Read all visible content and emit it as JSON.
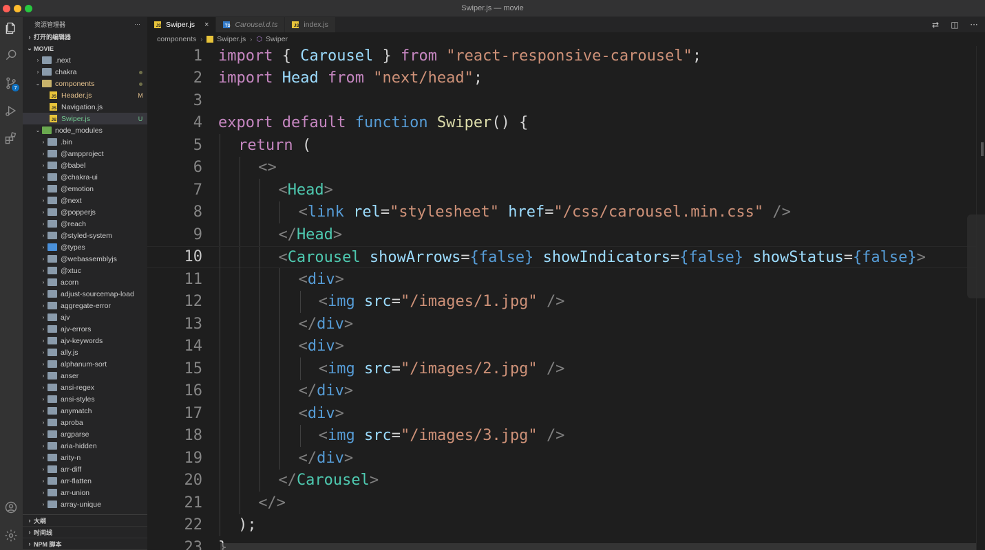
{
  "window": {
    "title": "Swiper.js — movie"
  },
  "activity": {
    "scm_badge": "7"
  },
  "sidebar": {
    "header": "资源管理器",
    "more": "···",
    "open_editors": "打开的编辑器",
    "root": "MOVIE",
    "tree": [
      {
        "name": ".next",
        "indent": 1,
        "kind": "folder",
        "status": ""
      },
      {
        "name": "chakra",
        "indent": 1,
        "kind": "folder",
        "status": "dot"
      },
      {
        "name": "components",
        "indent": 1,
        "kind": "folder-open",
        "status": "dot",
        "color": "mod"
      },
      {
        "name": "Header.js",
        "indent": 2,
        "kind": "js",
        "status": "M",
        "color": "mod"
      },
      {
        "name": "Navigation.js",
        "indent": 2,
        "kind": "js",
        "status": ""
      },
      {
        "name": "Swiper.js",
        "indent": 2,
        "kind": "js",
        "status": "U",
        "color": "untracked",
        "selected": true
      },
      {
        "name": "node_modules",
        "indent": 1,
        "kind": "folder-green-open",
        "status": ""
      },
      {
        "name": ".bin",
        "indent": 2,
        "kind": "folder",
        "status": ""
      },
      {
        "name": "@ampproject",
        "indent": 2,
        "kind": "folder",
        "status": ""
      },
      {
        "name": "@babel",
        "indent": 2,
        "kind": "folder",
        "status": ""
      },
      {
        "name": "@chakra-ui",
        "indent": 2,
        "kind": "folder",
        "status": ""
      },
      {
        "name": "@emotion",
        "indent": 2,
        "kind": "folder",
        "status": ""
      },
      {
        "name": "@next",
        "indent": 2,
        "kind": "folder",
        "status": ""
      },
      {
        "name": "@popperjs",
        "indent": 2,
        "kind": "folder",
        "status": ""
      },
      {
        "name": "@reach",
        "indent": 2,
        "kind": "folder",
        "status": ""
      },
      {
        "name": "@styled-system",
        "indent": 2,
        "kind": "folder",
        "status": ""
      },
      {
        "name": "@types",
        "indent": 2,
        "kind": "folder-blue",
        "status": ""
      },
      {
        "name": "@webassemblyjs",
        "indent": 2,
        "kind": "folder",
        "status": ""
      },
      {
        "name": "@xtuc",
        "indent": 2,
        "kind": "folder",
        "status": ""
      },
      {
        "name": "acorn",
        "indent": 2,
        "kind": "folder",
        "status": ""
      },
      {
        "name": "adjust-sourcemap-loader",
        "indent": 2,
        "kind": "folder",
        "status": ""
      },
      {
        "name": "aggregate-error",
        "indent": 2,
        "kind": "folder",
        "status": ""
      },
      {
        "name": "ajv",
        "indent": 2,
        "kind": "folder",
        "status": ""
      },
      {
        "name": "ajv-errors",
        "indent": 2,
        "kind": "folder",
        "status": ""
      },
      {
        "name": "ajv-keywords",
        "indent": 2,
        "kind": "folder",
        "status": ""
      },
      {
        "name": "ally.js",
        "indent": 2,
        "kind": "folder",
        "status": ""
      },
      {
        "name": "alphanum-sort",
        "indent": 2,
        "kind": "folder",
        "status": ""
      },
      {
        "name": "anser",
        "indent": 2,
        "kind": "folder",
        "status": ""
      },
      {
        "name": "ansi-regex",
        "indent": 2,
        "kind": "folder",
        "status": ""
      },
      {
        "name": "ansi-styles",
        "indent": 2,
        "kind": "folder",
        "status": ""
      },
      {
        "name": "anymatch",
        "indent": 2,
        "kind": "folder",
        "status": ""
      },
      {
        "name": "aproba",
        "indent": 2,
        "kind": "folder",
        "status": ""
      },
      {
        "name": "argparse",
        "indent": 2,
        "kind": "folder",
        "status": ""
      },
      {
        "name": "aria-hidden",
        "indent": 2,
        "kind": "folder",
        "status": ""
      },
      {
        "name": "arity-n",
        "indent": 2,
        "kind": "folder",
        "status": ""
      },
      {
        "name": "arr-diff",
        "indent": 2,
        "kind": "folder",
        "status": ""
      },
      {
        "name": "arr-flatten",
        "indent": 2,
        "kind": "folder",
        "status": ""
      },
      {
        "name": "arr-union",
        "indent": 2,
        "kind": "folder",
        "status": ""
      },
      {
        "name": "array-unique",
        "indent": 2,
        "kind": "folder",
        "status": ""
      }
    ],
    "bottom_sections": [
      "大纲",
      "时间线",
      "NPM 脚本"
    ]
  },
  "tabs": [
    {
      "label": "Swiper.js",
      "icon": "js",
      "active": true,
      "close": "×"
    },
    {
      "label": "Carousel.d.ts",
      "icon": "ts",
      "active": false,
      "italic": true
    },
    {
      "label": "index.js",
      "icon": "js",
      "active": false
    }
  ],
  "breadcrumb": {
    "folder": "components",
    "file": "Swiper.js",
    "symbol": "Swiper"
  },
  "editor": {
    "current_line": 10,
    "lines": [
      {
        "n": "1",
        "indent": 0,
        "tokens": [
          [
            "kw",
            "import"
          ],
          [
            "pun",
            " { "
          ],
          [
            "var",
            "Carousel"
          ],
          [
            "pun",
            " } "
          ],
          [
            "kw",
            "from"
          ],
          [
            "pun",
            " "
          ],
          [
            "str",
            "\"react-responsive-carousel\""
          ],
          [
            "pun",
            ";"
          ]
        ]
      },
      {
        "n": "2",
        "indent": 0,
        "tokens": [
          [
            "kw",
            "import"
          ],
          [
            "pun",
            " "
          ],
          [
            "var",
            "Head"
          ],
          [
            "pun",
            " "
          ],
          [
            "kw",
            "from"
          ],
          [
            "pun",
            " "
          ],
          [
            "str",
            "\"next/head\""
          ],
          [
            "pun",
            ";"
          ]
        ]
      },
      {
        "n": "3",
        "indent": 0,
        "tokens": []
      },
      {
        "n": "4",
        "indent": 0,
        "tokens": [
          [
            "kw",
            "export"
          ],
          [
            "pun",
            " "
          ],
          [
            "kw",
            "default"
          ],
          [
            "pun",
            " "
          ],
          [
            "kw2",
            "function"
          ],
          [
            "pun",
            " "
          ],
          [
            "fn",
            "Swiper"
          ],
          [
            "pun",
            "() {"
          ]
        ]
      },
      {
        "n": "5",
        "indent": 1,
        "tokens": [
          [
            "kw",
            "return"
          ],
          [
            "pun",
            " ("
          ]
        ]
      },
      {
        "n": "6",
        "indent": 2,
        "tokens": [
          [
            "brk",
            "<>"
          ]
        ]
      },
      {
        "n": "7",
        "indent": 3,
        "tokens": [
          [
            "brk",
            "<"
          ],
          [
            "comp",
            "Head"
          ],
          [
            "brk",
            ">"
          ]
        ]
      },
      {
        "n": "8",
        "indent": 4,
        "tokens": [
          [
            "brk",
            "<"
          ],
          [
            "tag",
            "link"
          ],
          [
            "pun",
            " "
          ],
          [
            "attr",
            "rel"
          ],
          [
            "pun",
            "="
          ],
          [
            "str",
            "\"stylesheet\""
          ],
          [
            "pun",
            " "
          ],
          [
            "attr",
            "href"
          ],
          [
            "pun",
            "="
          ],
          [
            "str",
            "\"/css/carousel.min.css\""
          ],
          [
            "pun",
            " "
          ],
          [
            "brk",
            "/>"
          ]
        ]
      },
      {
        "n": "9",
        "indent": 3,
        "tokens": [
          [
            "brk",
            "</"
          ],
          [
            "comp",
            "Head"
          ],
          [
            "brk",
            ">"
          ]
        ]
      },
      {
        "n": "10",
        "indent": 3,
        "tokens": [
          [
            "brk",
            "<"
          ],
          [
            "comp",
            "Carousel"
          ],
          [
            "pun",
            " "
          ],
          [
            "attr",
            "showArrows"
          ],
          [
            "pun",
            "="
          ],
          [
            "kw2",
            "{false}"
          ],
          [
            "pun",
            " "
          ],
          [
            "attr",
            "showIndicators"
          ],
          [
            "pun",
            "="
          ],
          [
            "kw2",
            "{false}"
          ],
          [
            "pun",
            " "
          ],
          [
            "attr",
            "showStatus"
          ],
          [
            "pun",
            "="
          ],
          [
            "kw2",
            "{false}"
          ],
          [
            "brk",
            ">"
          ]
        ]
      },
      {
        "n": "11",
        "indent": 4,
        "tokens": [
          [
            "brk",
            "<"
          ],
          [
            "tag",
            "div"
          ],
          [
            "brk",
            ">"
          ]
        ]
      },
      {
        "n": "12",
        "indent": 5,
        "tokens": [
          [
            "brk",
            "<"
          ],
          [
            "tag",
            "img"
          ],
          [
            "pun",
            " "
          ],
          [
            "attr",
            "src"
          ],
          [
            "pun",
            "="
          ],
          [
            "str",
            "\"/images/1.jpg\""
          ],
          [
            "pun",
            " "
          ],
          [
            "brk",
            "/>"
          ]
        ]
      },
      {
        "n": "13",
        "indent": 4,
        "tokens": [
          [
            "brk",
            "</"
          ],
          [
            "tag",
            "div"
          ],
          [
            "brk",
            ">"
          ]
        ]
      },
      {
        "n": "14",
        "indent": 4,
        "tokens": [
          [
            "brk",
            "<"
          ],
          [
            "tag",
            "div"
          ],
          [
            "brk",
            ">"
          ]
        ]
      },
      {
        "n": "15",
        "indent": 5,
        "tokens": [
          [
            "brk",
            "<"
          ],
          [
            "tag",
            "img"
          ],
          [
            "pun",
            " "
          ],
          [
            "attr",
            "src"
          ],
          [
            "pun",
            "="
          ],
          [
            "str",
            "\"/images/2.jpg\""
          ],
          [
            "pun",
            " "
          ],
          [
            "brk",
            "/>"
          ]
        ]
      },
      {
        "n": "16",
        "indent": 4,
        "tokens": [
          [
            "brk",
            "</"
          ],
          [
            "tag",
            "div"
          ],
          [
            "brk",
            ">"
          ]
        ]
      },
      {
        "n": "17",
        "indent": 4,
        "tokens": [
          [
            "brk",
            "<"
          ],
          [
            "tag",
            "div"
          ],
          [
            "brk",
            ">"
          ]
        ]
      },
      {
        "n": "18",
        "indent": 5,
        "tokens": [
          [
            "brk",
            "<"
          ],
          [
            "tag",
            "img"
          ],
          [
            "pun",
            " "
          ],
          [
            "attr",
            "src"
          ],
          [
            "pun",
            "="
          ],
          [
            "str",
            "\"/images/3.jpg\""
          ],
          [
            "pun",
            " "
          ],
          [
            "brk",
            "/>"
          ]
        ]
      },
      {
        "n": "19",
        "indent": 4,
        "tokens": [
          [
            "brk",
            "</"
          ],
          [
            "tag",
            "div"
          ],
          [
            "brk",
            ">"
          ]
        ]
      },
      {
        "n": "20",
        "indent": 3,
        "tokens": [
          [
            "brk",
            "</"
          ],
          [
            "comp",
            "Carousel"
          ],
          [
            "brk",
            ">"
          ]
        ]
      },
      {
        "n": "21",
        "indent": 2,
        "tokens": [
          [
            "brk",
            "</>"
          ]
        ]
      },
      {
        "n": "22",
        "indent": 1,
        "tokens": [
          [
            "pun",
            ");"
          ]
        ]
      },
      {
        "n": "23",
        "indent": 0,
        "tokens": [
          [
            "pun",
            "}"
          ]
        ]
      }
    ]
  }
}
